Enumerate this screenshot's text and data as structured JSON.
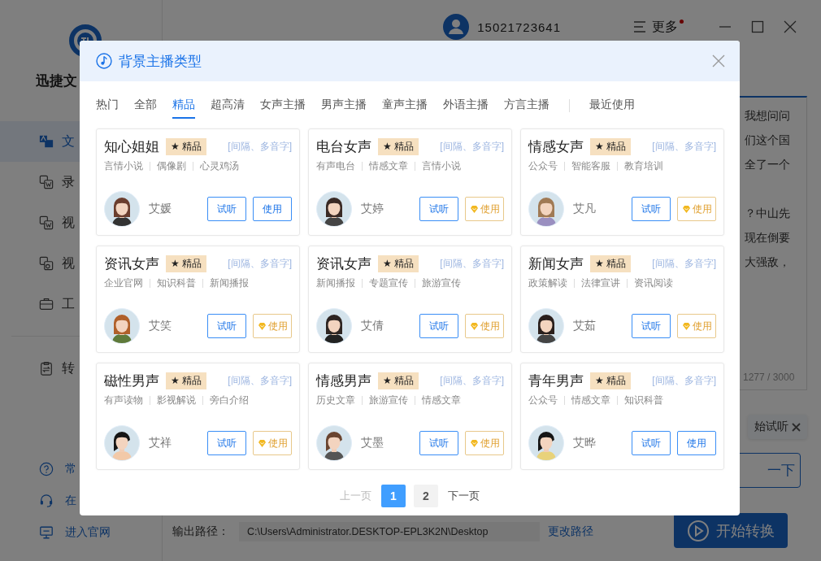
{
  "sidebar": {
    "app_name": "迅捷文",
    "items": [
      {
        "label": "文",
        "selected": true
      },
      {
        "label": "录",
        "selected": false
      },
      {
        "label": "视",
        "selected": false
      },
      {
        "label": "视",
        "selected": false
      },
      {
        "label": "工",
        "selected": false
      }
    ],
    "extra_items": [
      {
        "label": "转",
        "selected": false
      }
    ],
    "footer_links": [
      {
        "label": "常"
      },
      {
        "label": "在"
      },
      {
        "label": "进入官网"
      }
    ]
  },
  "top_bar": {
    "account": "15021723641",
    "more": {
      "label": "更多",
      "notification": true
    }
  },
  "editor": {
    "lines": [
      {
        "text": "我想问问",
        "paragraph_start": false
      },
      {
        "text": "们这个国",
        "paragraph_start": false
      },
      {
        "text": "全了一个",
        "paragraph_start": false
      },
      {
        "text": "？中山先",
        "paragraph_start": true
      },
      {
        "text": "现在倒要",
        "paragraph_start": false
      },
      {
        "text": "大强敌，",
        "paragraph_start": false
      }
    ],
    "count": "1277 / 3000"
  },
  "chip": {
    "label": "始试听"
  },
  "try_button": "一下",
  "output": {
    "label": "输出路径：",
    "path": "C:\\Users\\Administrator.DESKTOP-EPL3K2N\\Desktop",
    "change": "更改路径"
  },
  "start_button": "开始转换",
  "modal": {
    "title": "背景主播类型",
    "tabs": [
      {
        "label": "热门",
        "selected": false
      },
      {
        "label": "全部",
        "selected": false
      },
      {
        "label": "精品",
        "selected": true
      },
      {
        "label": "超高清",
        "selected": false
      },
      {
        "label": "女声主播",
        "selected": false
      },
      {
        "label": "男声主播",
        "selected": false
      },
      {
        "label": "童声主播",
        "selected": false
      },
      {
        "label": "外语主播",
        "selected": false
      },
      {
        "label": "方言主播",
        "selected": false
      },
      {
        "label": "最近使用",
        "selected": false
      }
    ],
    "cards": [
      {
        "title": "知心姐姐",
        "badge": "★ 精品",
        "link": "[间隔、多音字]",
        "tags": [
          "言情小说",
          "偶像剧",
          "心灵鸡汤"
        ],
        "name": "艾媛",
        "listen": "试听",
        "use": "使用",
        "kind": "free"
      },
      {
        "title": "电台女声",
        "badge": "★ 精品",
        "link": "[间隔、多音字]",
        "tags": [
          "有声电台",
          "情感文章",
          "言情小说"
        ],
        "name": "艾婷",
        "listen": "试听",
        "use": "使用",
        "kind": "vip"
      },
      {
        "title": "情感女声",
        "badge": "★ 精品",
        "link": "[间隔、多音字]",
        "tags": [
          "公众号",
          "智能客服",
          "教育培训"
        ],
        "name": "艾凡",
        "listen": "试听",
        "use": "使用",
        "kind": "vip"
      },
      {
        "title": "资讯女声",
        "badge": "★ 精品",
        "link": "[间隔、多音字]",
        "tags": [
          "企业官网",
          "知识科普",
          "新闻播报"
        ],
        "name": "艾笑",
        "listen": "试听",
        "use": "使用",
        "kind": "vip"
      },
      {
        "title": "资讯女声",
        "badge": "★ 精品",
        "link": "[间隔、多音字]",
        "tags": [
          "新闻播报",
          "专题宣传",
          "旅游宣传"
        ],
        "name": "艾倩",
        "listen": "试听",
        "use": "使用",
        "kind": "vip"
      },
      {
        "title": "新闻女声",
        "badge": "★ 精品",
        "link": "[间隔、多音字]",
        "tags": [
          "政策解读",
          "法律宣讲",
          "资讯阅读"
        ],
        "name": "艾茹",
        "listen": "试听",
        "use": "使用",
        "kind": "vip"
      },
      {
        "title": "磁性男声",
        "badge": "★ 精品",
        "link": "[间隔、多音字]",
        "tags": [
          "有声读物",
          "影视解说",
          "旁白介绍"
        ],
        "name": "艾祥",
        "listen": "试听",
        "use": "使用",
        "kind": "vip"
      },
      {
        "title": "情感男声",
        "badge": "★ 精品",
        "link": "[间隔、多音字]",
        "tags": [
          "历史文章",
          "旅游宣传",
          "情感文章"
        ],
        "name": "艾墨",
        "listen": "试听",
        "use": "使用",
        "kind": "vip"
      },
      {
        "title": "青年男声",
        "badge": "★ 精品",
        "link": "[间隔、多音字]",
        "tags": [
          "公众号",
          "情感文章",
          "知识科普"
        ],
        "name": "艾晔",
        "listen": "试听",
        "use": "使用",
        "kind": "free"
      }
    ],
    "pagination": {
      "prev": {
        "label": "上一页",
        "disabled": true
      },
      "pages": [
        {
          "label": "1",
          "selected": true
        },
        {
          "label": "2",
          "selected": false
        }
      ],
      "next": {
        "label": "下一页",
        "disabled": false
      }
    }
  }
}
